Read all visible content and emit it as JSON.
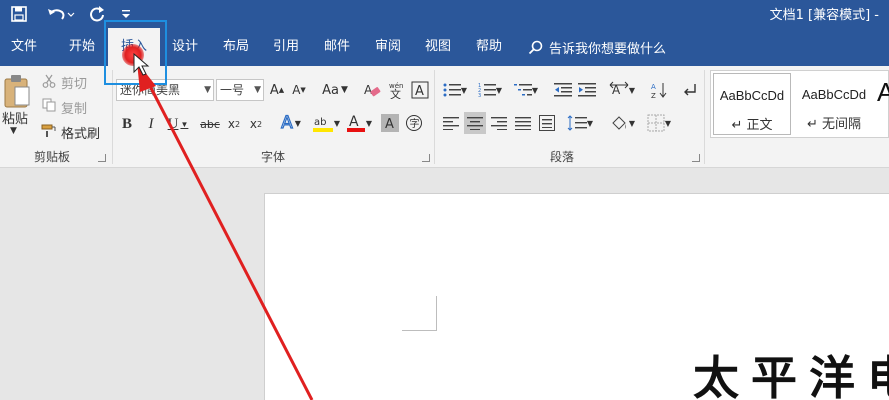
{
  "title_bar": {
    "doc_title": "文档1 [兼容模式] -"
  },
  "tabs": [
    {
      "label": "文件"
    },
    {
      "label": "开始"
    },
    {
      "label": "插入"
    },
    {
      "label": "设计"
    },
    {
      "label": "布局"
    },
    {
      "label": "引用"
    },
    {
      "label": "邮件"
    },
    {
      "label": "审阅"
    },
    {
      "label": "视图"
    },
    {
      "label": "帮助"
    }
  ],
  "tell_me": "告诉我你想要做什么",
  "clipboard": {
    "paste": "粘贴",
    "cut": "剪切",
    "copy": "复制",
    "format_painter": "格式刷",
    "group_label": "剪贴板"
  },
  "font": {
    "font_name": "迷你简美黑",
    "font_size": "一号",
    "group_label": "字体"
  },
  "paragraph": {
    "group_label": "段落"
  },
  "styles": {
    "items": [
      {
        "sample": "AaBbCcDd",
        "name": "正文"
      },
      {
        "sample": "AaBbCcDd",
        "name": "无间隔"
      },
      {
        "sample": "A",
        "name": ""
      }
    ]
  },
  "document": {
    "heading": "太平洋电"
  },
  "colors": {
    "ribbon_blue": "#2b579a",
    "highlight_box": "#1e8fe0",
    "annotation_arrow": "#e02020",
    "highlight_yellow": "#ffe600",
    "font_color_red": "#e81010"
  },
  "icons": [
    "save-icon",
    "undo-icon",
    "redo-icon",
    "customize-toolbar-icon",
    "search-icon",
    "paste-icon",
    "cut-icon",
    "copy-icon",
    "format-painter-icon",
    "bold-icon",
    "italic-icon",
    "underline-icon",
    "strikethrough-icon",
    "subscript-icon",
    "superscript-icon",
    "text-effects-icon",
    "highlight-icon",
    "font-color-icon",
    "character-shading-icon",
    "enclose-characters-icon",
    "grow-font-icon",
    "shrink-font-icon",
    "change-case-icon",
    "clear-formatting-icon",
    "phonetic-guide-icon",
    "character-border-icon",
    "bullets-icon",
    "numbering-icon",
    "multilevel-list-icon",
    "decrease-indent-icon",
    "increase-indent-icon",
    "sort-icon",
    "show-marks-icon",
    "align-left-icon",
    "center-icon",
    "align-right-icon",
    "justify-icon",
    "distributed-icon",
    "line-spacing-icon",
    "shading-icon",
    "borders-icon",
    "text-direction-icon",
    "cursor-icon"
  ]
}
